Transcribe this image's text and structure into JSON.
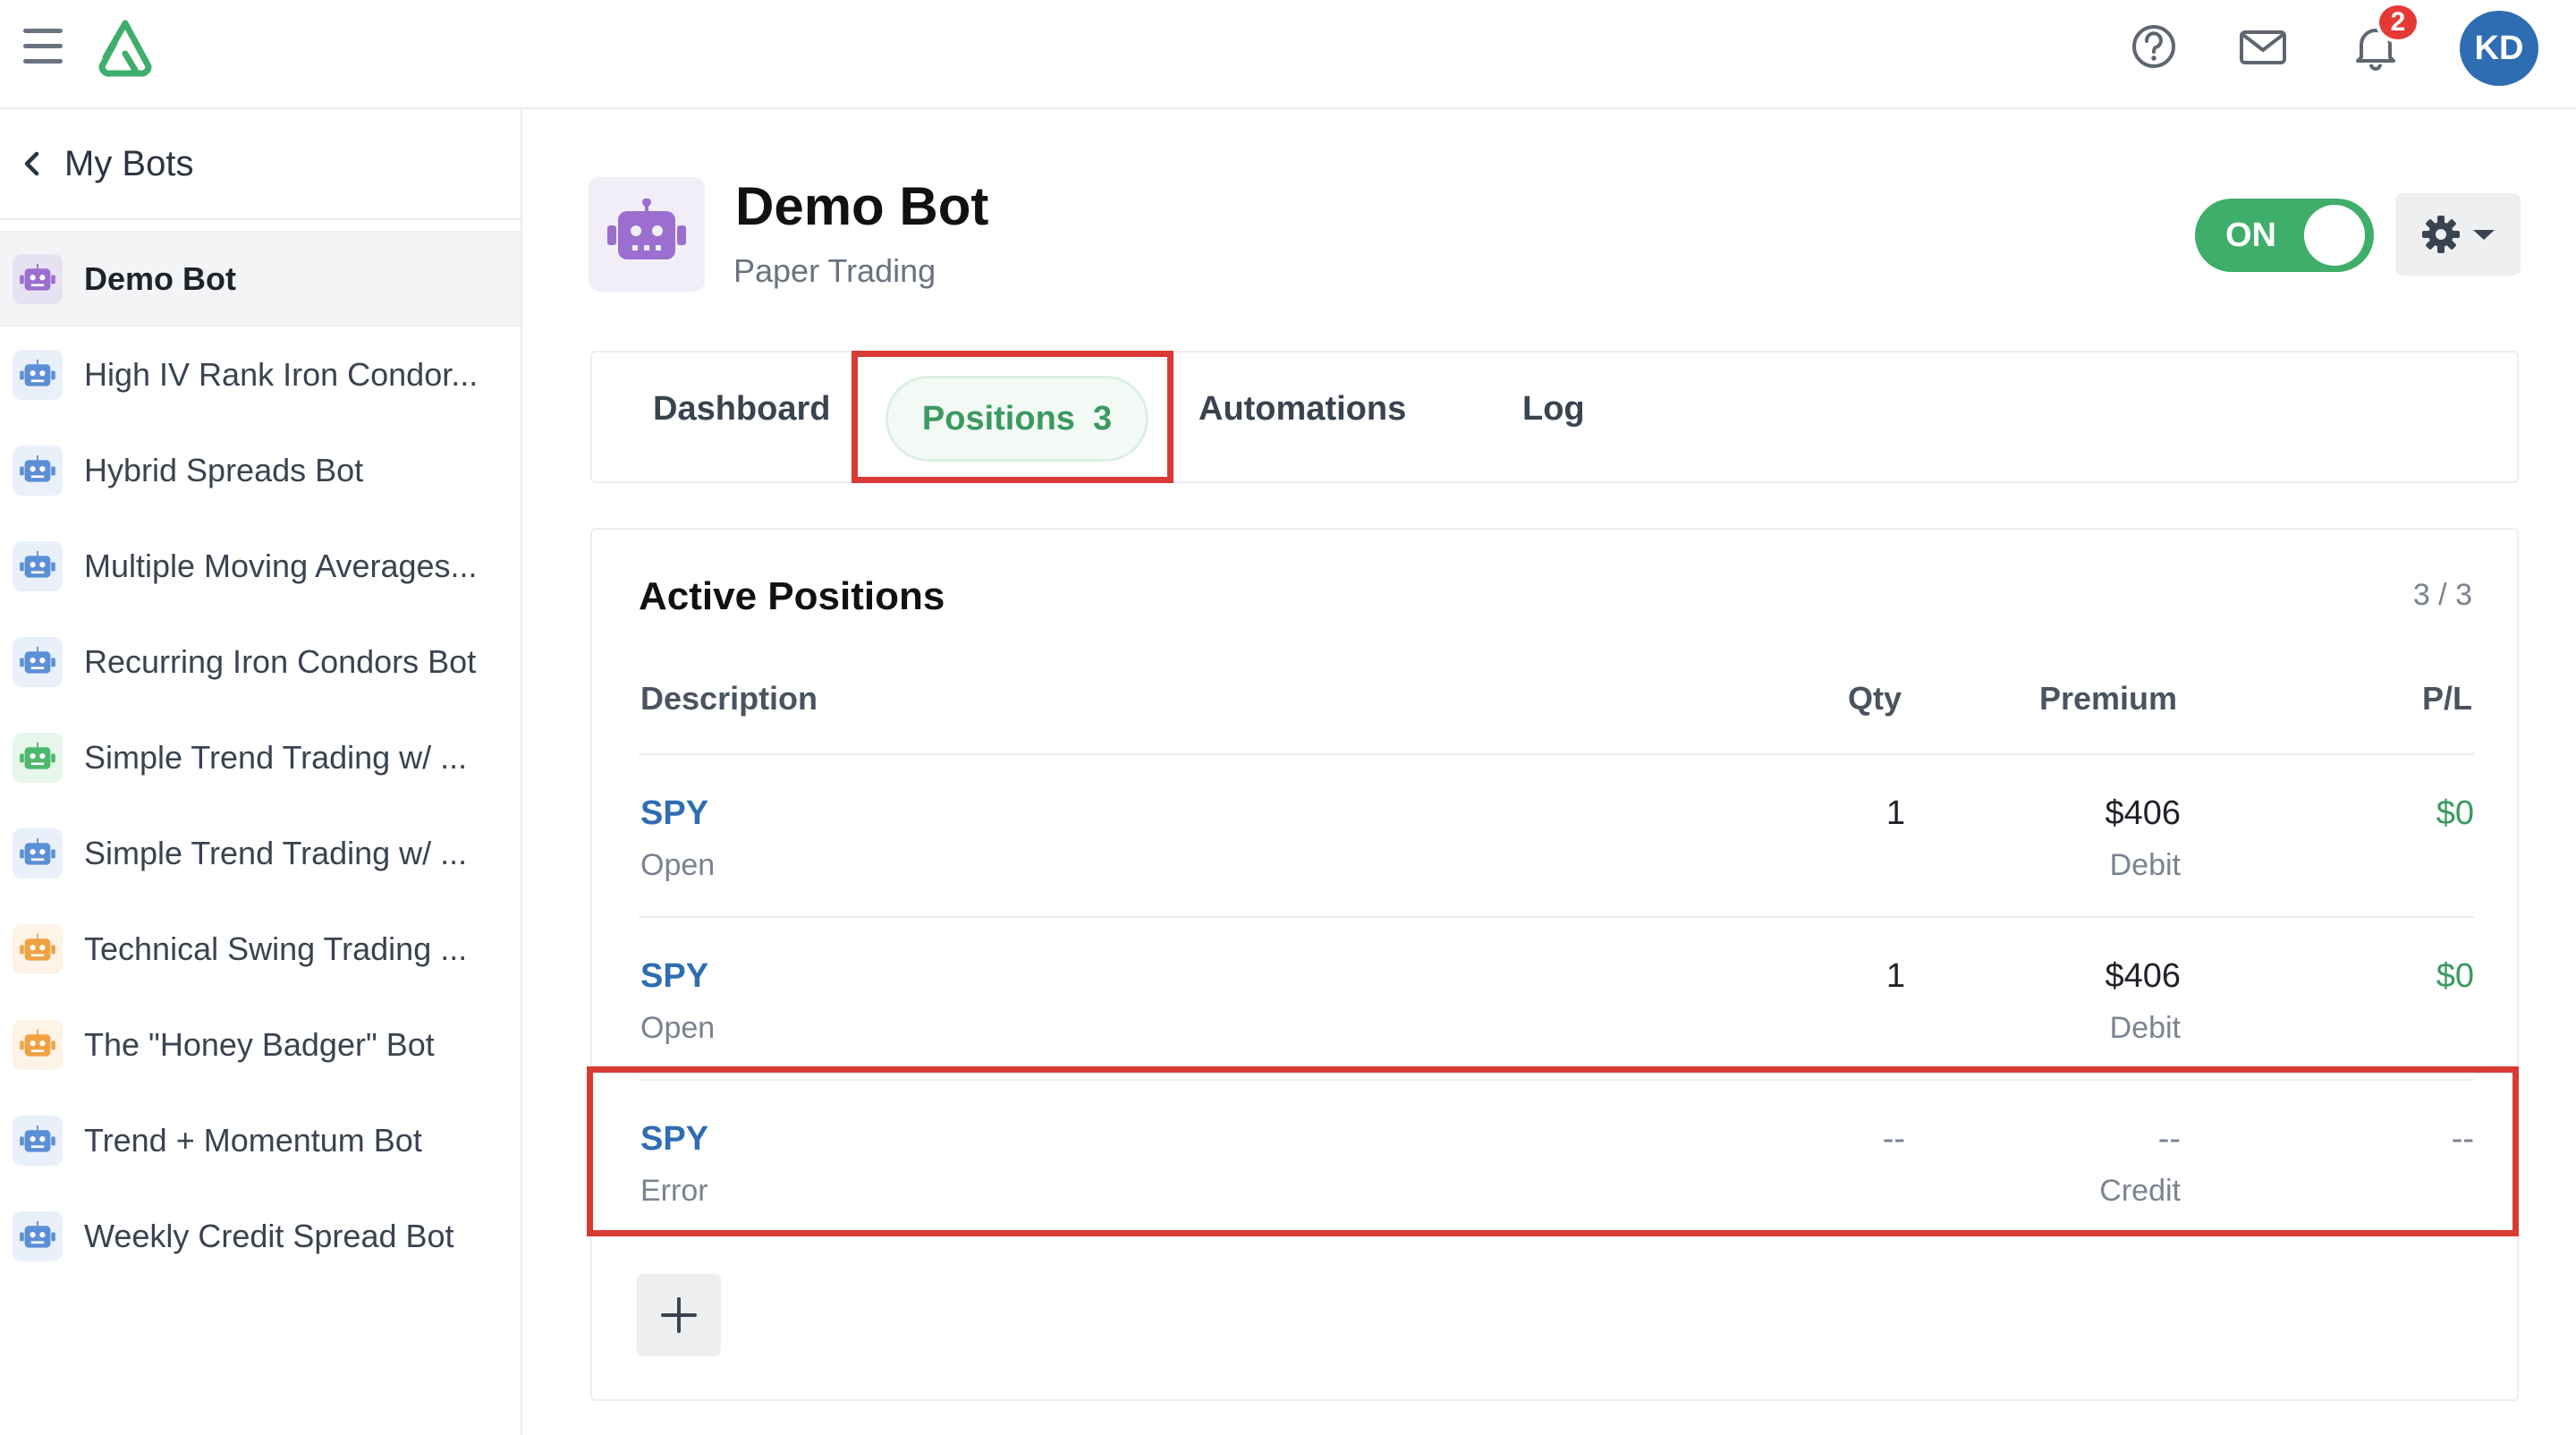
{
  "header": {
    "notification_count": "2",
    "user_initials": "KD",
    "icons": [
      "menu-icon",
      "logo-icon",
      "help-icon",
      "mail-icon",
      "bell-icon"
    ]
  },
  "sidebar": {
    "back_label": "My Bots",
    "bots": [
      {
        "name": "Demo Bot",
        "color": "#9b6ecf",
        "active": true
      },
      {
        "name": "High IV Rank Iron Condor...",
        "color": "#5b8fd6"
      },
      {
        "name": "Hybrid Spreads Bot",
        "color": "#5b8fd6"
      },
      {
        "name": "Multiple Moving Averages...",
        "color": "#5b8fd6"
      },
      {
        "name": "Recurring Iron Condors Bot",
        "color": "#5b8fd6"
      },
      {
        "name": "Simple Trend Trading w/ ...",
        "color": "#4cb86a"
      },
      {
        "name": "Simple Trend Trading w/ ...",
        "color": "#5b8fd6"
      },
      {
        "name": "Technical Swing Trading ...",
        "color": "#f0a243"
      },
      {
        "name": "The \"Honey Badger\" Bot",
        "color": "#f0a243"
      },
      {
        "name": "Trend + Momentum Bot",
        "color": "#5b8fd6"
      },
      {
        "name": "Weekly Credit Spread Bot",
        "color": "#5b8fd6"
      }
    ]
  },
  "bot": {
    "title": "Demo Bot",
    "subtitle": "Paper Trading",
    "toggle_label": "ON",
    "toggle_on": true
  },
  "tabs": {
    "dashboard": "Dashboard",
    "positions": "Positions",
    "positions_count": "3",
    "automations": "Automations",
    "log": "Log"
  },
  "positions": {
    "title": "Active Positions",
    "count_label": "3 / 3",
    "columns": {
      "description": "Description",
      "qty": "Qty",
      "premium": "Premium",
      "pl": "P/L"
    },
    "rows": [
      {
        "symbol": "SPY",
        "status": "Open",
        "qty": "1",
        "premium": "$406",
        "premium_type": "Debit",
        "pl": "$0"
      },
      {
        "symbol": "SPY",
        "status": "Open",
        "qty": "1",
        "premium": "$406",
        "premium_type": "Debit",
        "pl": "$0"
      },
      {
        "symbol": "SPY",
        "status": "Error",
        "qty": "--",
        "premium": "--",
        "premium_type": "Credit",
        "pl": "--"
      }
    ],
    "add_label": "+"
  },
  "colors": {
    "accent_green": "#3fae6a",
    "link_blue": "#2f6db3",
    "highlight_red": "#d93a33"
  }
}
